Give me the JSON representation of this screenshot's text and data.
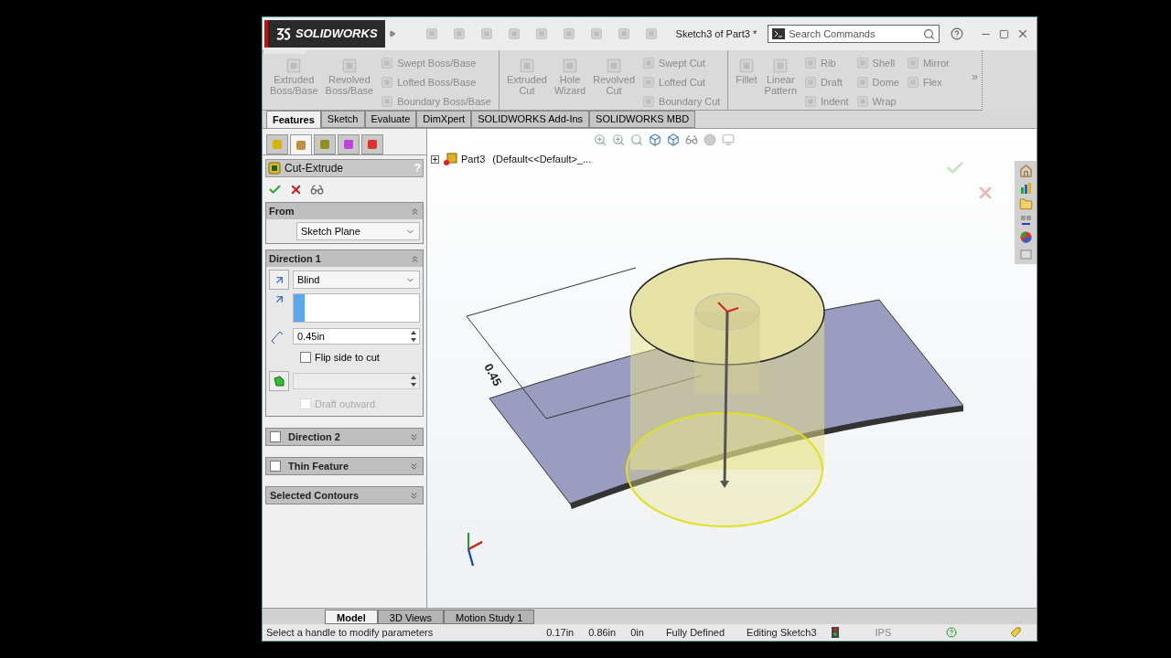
{
  "title_bar": {
    "logo": "SOLIDWORKS",
    "document_title": "Sketch3 of Part3 *",
    "search": {
      "placeholder": "Search Commands"
    }
  },
  "ribbon": {
    "groups": [
      {
        "large": [
          "Extruded\nBoss/Base",
          "Revolved\nBoss/Base"
        ],
        "small": [
          [
            "Swept Boss/Base",
            "Lofted Boss/Base",
            "Boundary Boss/Base"
          ]
        ]
      },
      {
        "large": [
          "Extruded\nCut",
          "Hole\nWizard",
          "Revolved\nCut"
        ],
        "small": [
          [
            "Swept Cut",
            "Lofted Cut",
            "Boundary Cut"
          ]
        ]
      },
      {
        "large": [
          "Fillet",
          "Linear\nPattern"
        ],
        "small": [
          [
            "Rib",
            "Draft",
            "Indent"
          ],
          [
            "Shell",
            "Dome",
            "Wrap"
          ],
          [
            "Mirror",
            "Flex"
          ]
        ]
      }
    ],
    "more": "»"
  },
  "tabs": [
    {
      "label": "Features",
      "selected": true
    },
    {
      "label": "Sketch",
      "selected": false
    },
    {
      "label": "Evaluate",
      "selected": false
    },
    {
      "label": "DimXpert",
      "selected": false
    },
    {
      "label": "SOLIDWORKS Add-Ins",
      "selected": false
    },
    {
      "label": "SOLIDWORKS MBD",
      "selected": false
    }
  ],
  "panel_tabs": [
    {
      "selected": false
    },
    {
      "selected": true
    },
    {
      "selected": false
    },
    {
      "selected": false
    },
    {
      "selected": false
    }
  ],
  "property_manager": {
    "title": "Cut-Extrude",
    "help": "?",
    "from": {
      "title": "From",
      "expanded": true,
      "value": "Sketch Plane"
    },
    "direction1": {
      "title": "Direction 1",
      "expanded": true,
      "end_condition": "Blind",
      "depth": "0.45in",
      "flip": {
        "label": "Flip side to cut",
        "checked": false
      },
      "draft": {
        "disabled": true
      },
      "draft_outward": {
        "label": "Draft outward",
        "checked": false,
        "disabled": true
      }
    },
    "collapsed_sections": [
      {
        "kind": "optional",
        "title": "Direction 2",
        "checked": false,
        "expanded": false
      },
      {
        "kind": "optional",
        "title": "Thin Feature",
        "checked": false,
        "expanded": false
      },
      {
        "kind": "plain",
        "title": "Selected Contours",
        "expanded": false
      }
    ]
  },
  "tree": {
    "part": "Part3",
    "configuration": "(Default<<Default>_..."
  },
  "viewport": {
    "dimension": "0.45"
  },
  "bottom_tabs": [
    {
      "label": "Model",
      "selected": true
    },
    {
      "label": "3D Views",
      "selected": false
    },
    {
      "label": "Motion Study 1",
      "selected": false
    }
  ],
  "status_bar": {
    "message": "Select a handle to modify parameters",
    "readings": [
      "0.17in",
      "0.86in",
      "0in"
    ],
    "state": "Fully Defined",
    "mode": "Editing Sketch3",
    "units": "IPS"
  }
}
